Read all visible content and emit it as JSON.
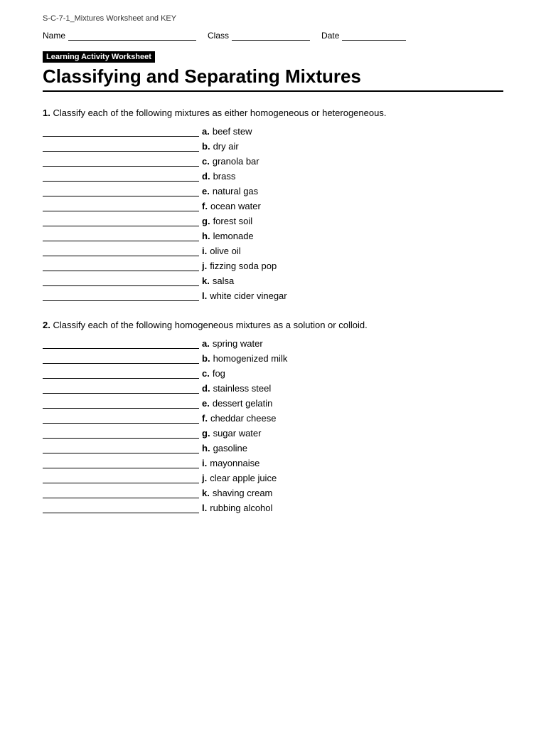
{
  "file": {
    "title": "S-C-7-1_Mixtures Worksheet and KEY"
  },
  "header": {
    "name_label": "Name",
    "class_label": "Class",
    "date_label": "Date"
  },
  "badge": {
    "text": "Learning Activity Worksheet"
  },
  "worksheet": {
    "title": "Classifying and Separating Mixtures"
  },
  "questions": [
    {
      "number": "1.",
      "text": "Classify each of the following mixtures as either homogeneous or heterogeneous.",
      "items": [
        {
          "label": "a.",
          "text": "beef stew"
        },
        {
          "label": "b.",
          "text": "dry air"
        },
        {
          "label": "c.",
          "text": "granola bar"
        },
        {
          "label": "d.",
          "text": "brass"
        },
        {
          "label": "e.",
          "text": "natural gas"
        },
        {
          "label": "f.",
          "text": "ocean water"
        },
        {
          "label": "g.",
          "text": "forest soil"
        },
        {
          "label": "h.",
          "text": "lemonade"
        },
        {
          "label": "i.",
          "text": "olive oil"
        },
        {
          "label": "j.",
          "text": "fizzing soda pop"
        },
        {
          "label": "k.",
          "text": "salsa"
        },
        {
          "label": "l.",
          "text": "white cider vinegar"
        }
      ]
    },
    {
      "number": "2.",
      "text": "Classify each of the following homogeneous mixtures as a solution or colloid.",
      "items": [
        {
          "label": "a.",
          "text": "spring water"
        },
        {
          "label": "b.",
          "text": "homogenized milk"
        },
        {
          "label": "c.",
          "text": "fog"
        },
        {
          "label": "d.",
          "text": "stainless steel"
        },
        {
          "label": "e.",
          "text": "dessert gelatin"
        },
        {
          "label": "f.",
          "text": "cheddar cheese"
        },
        {
          "label": "g.",
          "text": "sugar water"
        },
        {
          "label": "h.",
          "text": "gasoline"
        },
        {
          "label": "i.",
          "text": "mayonnaise"
        },
        {
          "label": "j.",
          "text": "clear apple juice"
        },
        {
          "label": "k.",
          "text": "shaving cream"
        },
        {
          "label": "l.",
          "text": "rubbing alcohol"
        }
      ]
    }
  ]
}
